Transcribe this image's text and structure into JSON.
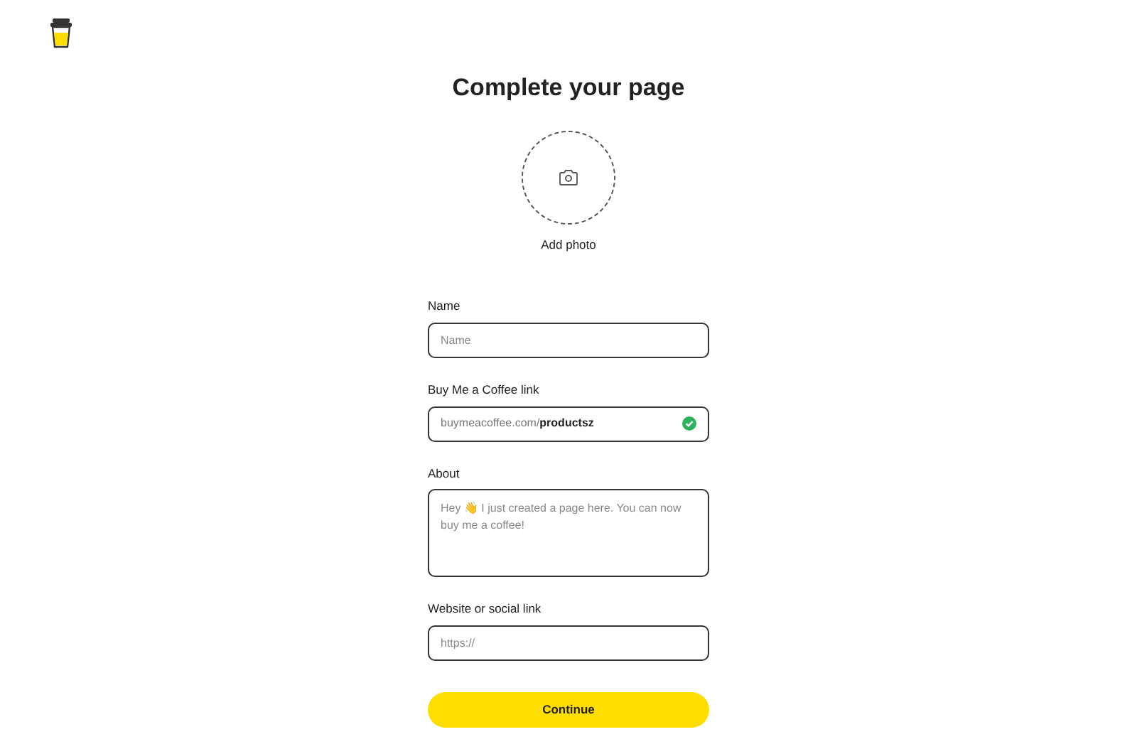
{
  "title": "Complete your page",
  "photo": {
    "label": "Add photo"
  },
  "fields": [
    {
      "kind": "input",
      "label": "Name",
      "placeholder": "Name"
    },
    {
      "kind": "link",
      "label": "Buy Me a Coffee link",
      "prefix": "buymeacoffee.com/",
      "value": "productsz",
      "verified": true
    },
    {
      "kind": "textarea",
      "label": "About",
      "placeholder": "Hey 👋 I just created a page here. You can now buy me a coffee!"
    },
    {
      "kind": "input",
      "label": "Website or social link",
      "placeholder": "https://"
    }
  ],
  "button": "Continue"
}
